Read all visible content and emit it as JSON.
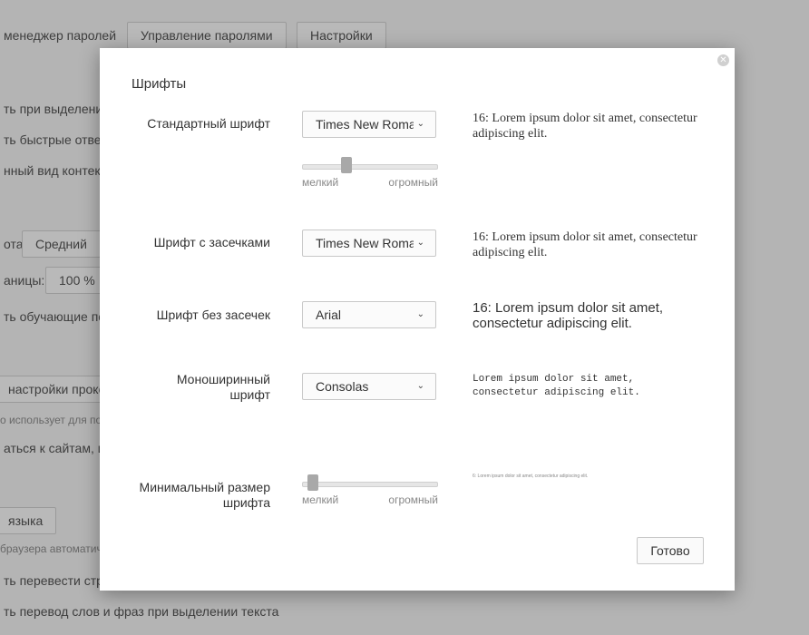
{
  "background": {
    "row_password_manager": "менеджер паролей",
    "btn_manage_passwords": "Управление паролями",
    "btn_settings": "Настройки",
    "row_on_selection": "ть при выделени",
    "row_quick_answers": "ть быстрые ответ",
    "row_context_view": "нный вид контекс",
    "font_size_label": "ота:",
    "font_size_value": "Средний",
    "page_zoom_label": "аницы:",
    "page_zoom_value": "100 %",
    "row_tutorial": "ть обучающие по",
    "btn_proxy": "настройки прокс",
    "proxy_note": "о использует для по",
    "row_connect_sites": "аться к сайтам, и",
    "btn_language": "языка",
    "browser_note": "браузера автоматич",
    "row_translate_pages": "ть перевести стра",
    "row_translate_words": "ть перевод слов и фраз при выделении текста"
  },
  "dialog": {
    "title": "Шрифты",
    "close_icon": "close-icon",
    "standard_font": {
      "label": "Стандартный шрифт",
      "value": "Times New Roman",
      "preview": "16: Lorem ipsum dolor sit amet, consectetur adipiscing elit.",
      "slider_min_label": "мелкий",
      "slider_max_label": "огромный",
      "slider_level": 0.31
    },
    "serif_font": {
      "label": "Шрифт с засечками",
      "value": "Times New Roman",
      "preview": "16: Lorem ipsum dolor sit amet, consectetur adipiscing elit."
    },
    "sans_font": {
      "label": "Шрифт без засечек",
      "value": "Arial",
      "preview": "16: Lorem ipsum dolor sit amet, consectetur adipiscing elit."
    },
    "mono_font": {
      "label_line1": "Моноширинный",
      "label_line2": "шрифт",
      "value": "Consolas",
      "preview": "Lorem ipsum dolor sit amet, consectetur adipiscing elit."
    },
    "min_font": {
      "label_line1": "Минимальный размер",
      "label_line2": "шрифта",
      "preview": "6: Lorem ipsum dolor sit amet, consectetur adipiscing elit.",
      "slider_min_label": "мелкий",
      "slider_max_label": "огромный",
      "slider_level": 0.04
    },
    "done_label": "Готово"
  }
}
